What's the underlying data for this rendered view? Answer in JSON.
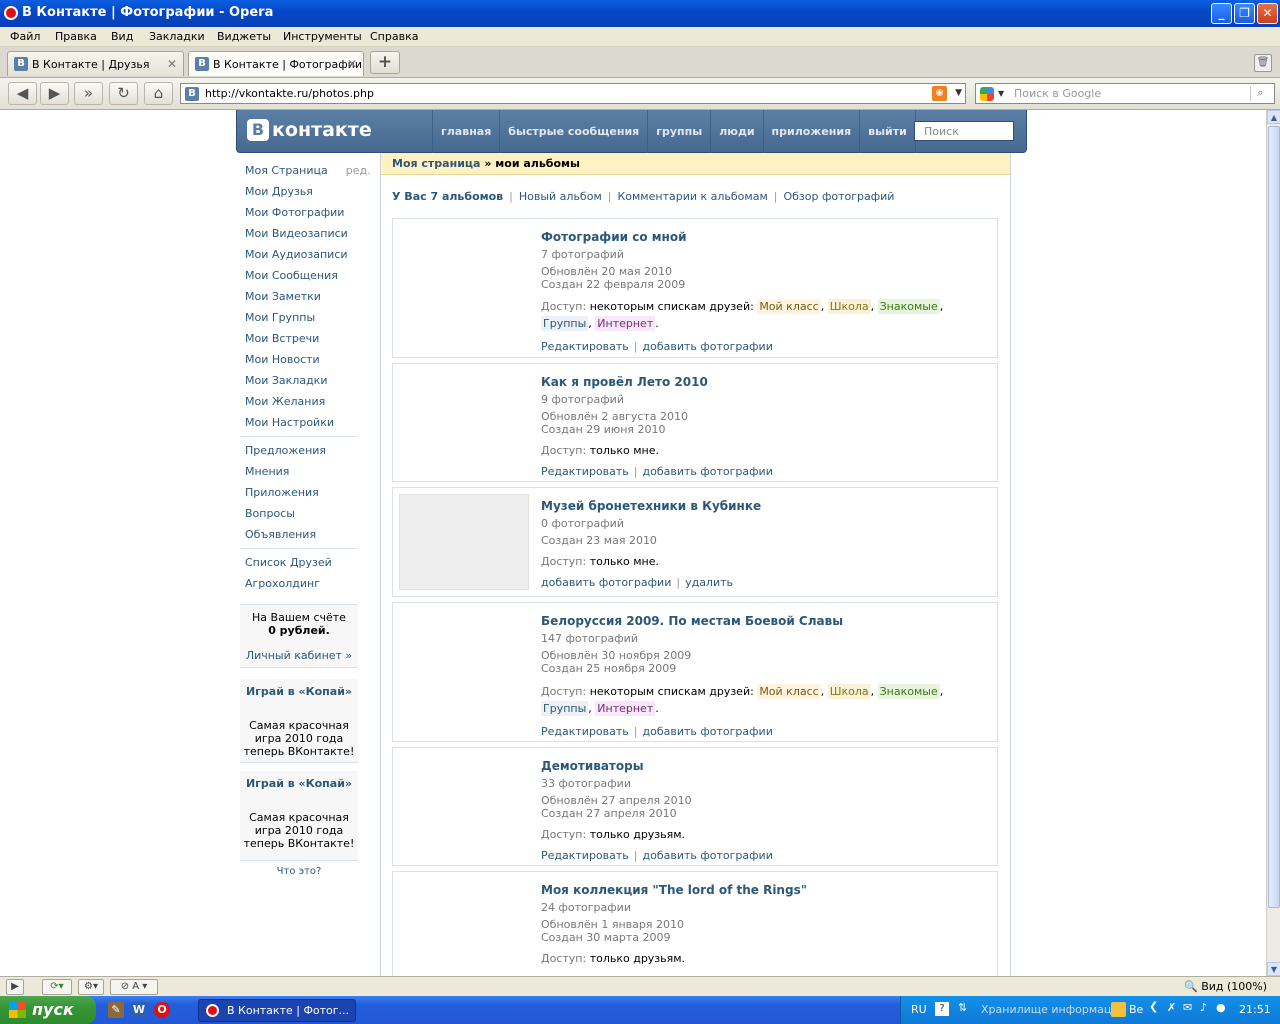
{
  "window": {
    "title": "В Контакте  |  Фотографии - Opera"
  },
  "menu": [
    "Файл",
    "Правка",
    "Вид",
    "Закладки",
    "Виджеты",
    "Инструменты",
    "Справка"
  ],
  "tabs": [
    {
      "icon": "B",
      "label": "В Контакте | Друзья"
    },
    {
      "icon": "B",
      "label": "В Контакте | Фотографии"
    }
  ],
  "newtab": "+",
  "address": {
    "url": "http://vkontakte.ru/photos.php"
  },
  "search": {
    "placeholder": "Поиск в Google"
  },
  "vk": {
    "logo_b": "В",
    "logo_text": "контакте",
    "nav": [
      "главная",
      "быстрые сообщения",
      "группы",
      "люди",
      "приложения",
      "выйти"
    ],
    "search_placeholder": "Поиск"
  },
  "sidebar": {
    "my_page": "Моя Страница",
    "edit": "ред.",
    "items1": [
      "Мои Друзья",
      "Мои Фотографии",
      "Мои Видеозаписи",
      "Мои Аудиозаписи",
      "Мои Сообщения",
      "Мои Заметки",
      "Мои Группы",
      "Мои Встречи",
      "Мои Новости",
      "Мои Закладки",
      "Мои Желания",
      "Мои Настройки"
    ],
    "items2": [
      "Предложения",
      "Мнения",
      "Приложения",
      "Вопросы",
      "Объявления"
    ],
    "items3": [
      "Список Друзей",
      "Агрохолдинг"
    ],
    "balance_line1": "На Вашем счёте",
    "balance_line2": "0 рублей.",
    "balance_link": "Личный кабинет »",
    "games": [
      {
        "title": "Играй в «Копай»",
        "desc": "Самая красочная игра 2010 года теперь ВКонтакте!"
      },
      {
        "title": "Играй в «Копай»",
        "desc": "Самая красочная игра 2010 года теперь ВКонтакте!"
      }
    ],
    "what": "Что это?"
  },
  "breadcrumb": {
    "root": "Моя страница",
    "sep": "»",
    "current": "мои альбомы"
  },
  "subnav": {
    "count": "У Вас 7 альбомов",
    "links": [
      "Новый альбом",
      "Комментарии к альбомам",
      "Обзор фотографий"
    ]
  },
  "albums": [
    {
      "title": "Фотографии со мной",
      "count": "7 фотографий",
      "updated": "Обновлён 20 мая 2010",
      "created": "Создан 22 февраля 2009",
      "access_label": "Доступ:",
      "access": "некоторым спискам друзей:",
      "tags": [
        "Мой класс",
        "Школа",
        "Знакомые",
        "Группы",
        "Интернет"
      ],
      "actions": [
        "Редактировать",
        "добавить фотографии"
      ]
    },
    {
      "title": "Как я провёл Лето 2010",
      "count": "9 фотографий",
      "updated": "Обновлён 2 августа 2010",
      "created": "Создан 29 июня 2010",
      "access_label": "Доступ:",
      "access": "только мне.",
      "actions": [
        "Редактировать",
        "добавить фотографии"
      ]
    },
    {
      "title": "Музей бронетехники в Кубинке",
      "count": "0 фотографий",
      "created": "Создан 23 мая 2010",
      "access_label": "Доступ:",
      "access": "только мне.",
      "actions": [
        "добавить фотографии",
        "удалить"
      ]
    },
    {
      "title": "Белоруссия 2009. По местам Боевой Славы",
      "count": "147 фотографий",
      "updated": "Обновлён 30 ноября 2009",
      "created": "Создан 25 ноября 2009",
      "access_label": "Доступ:",
      "access": "некоторым спискам друзей:",
      "tags": [
        "Мой класс",
        "Школа",
        "Знакомые",
        "Группы",
        "Интернет"
      ],
      "actions": [
        "Редактировать",
        "добавить фотографии"
      ]
    },
    {
      "title": "Демотиваторы",
      "count": "33 фотографии",
      "updated": "Обновлён 27 апреля 2010",
      "created": "Создан 27 апреля 2010",
      "access_label": "Доступ:",
      "access": "только друзьям.",
      "actions": [
        "Редактировать",
        "добавить фотографии"
      ]
    },
    {
      "title": "Моя коллекция \"The lord of the Rings\"",
      "count": "24 фотографии",
      "updated": "Обновлён 1 января 2010",
      "created": "Создан 30 марта 2009",
      "access_label": "Доступ:",
      "access": "только друзьям."
    }
  ],
  "status": {
    "zoom": "Вид (100%)"
  },
  "taskbar": {
    "start": "пуск",
    "task": "В Контакте | Фотог...",
    "lang": "RU",
    "tray_text": "Хранилище информации",
    "be": "Be",
    "clock": "21:51"
  }
}
